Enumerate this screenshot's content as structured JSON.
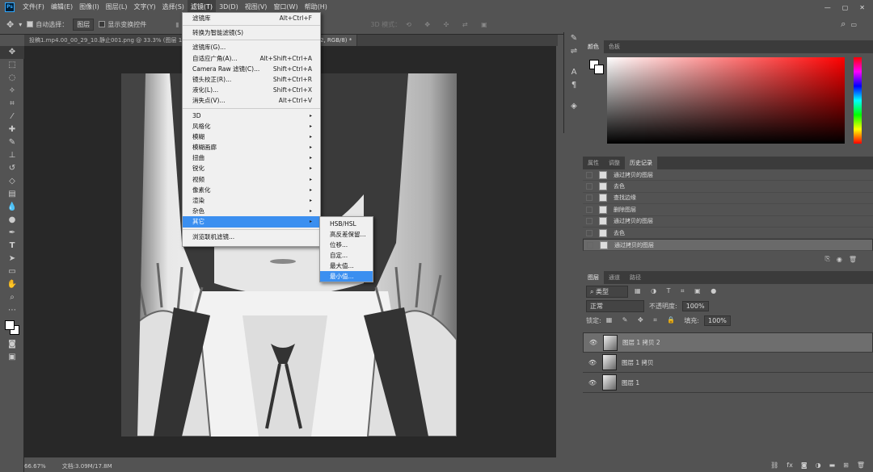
{
  "menubar": {
    "items": [
      "文件(F)",
      "编辑(E)",
      "图像(I)",
      "图层(L)",
      "文字(Y)",
      "选择(S)",
      "滤镜(T)",
      "3D(D)",
      "视图(V)",
      "窗口(W)",
      "帮助(H)"
    ],
    "active_index": 6
  },
  "options": {
    "auto_select_label": "自动选择：",
    "auto_select_value": "图层",
    "show_transform_label": "显示变换控件",
    "mode_3d_label": "3D 模式："
  },
  "tabs": [
    {
      "label": "投稿1.mp4.00_00_29_10.静止001.png @ 33.3% (图层 1 拷贝 2, RGB/8)",
      "active": false
    },
    {
      "label": "2, RGB/8) *",
      "active": true
    }
  ],
  "status": {
    "zoom": "66.67%",
    "doc": "文档:3.09M/17.8M"
  },
  "filter_menu": {
    "items": [
      {
        "label": "滤镜库",
        "shortcut": "Alt+Ctrl+F"
      },
      {
        "sep": true
      },
      {
        "label": "转换为智能滤镜(S)",
        "shortcut": ""
      },
      {
        "sep": true
      },
      {
        "label": "滤镜库(G)...",
        "shortcut": ""
      },
      {
        "label": "自适应广角(A)...",
        "shortcut": "Alt+Shift+Ctrl+A"
      },
      {
        "label": "Camera Raw 滤镜(C)...",
        "shortcut": "Shift+Ctrl+A"
      },
      {
        "label": "镜头校正(R)...",
        "shortcut": "Shift+Ctrl+R"
      },
      {
        "label": "液化(L)...",
        "shortcut": "Shift+Ctrl+X"
      },
      {
        "label": "消失点(V)...",
        "shortcut": "Alt+Ctrl+V"
      },
      {
        "sep": true
      },
      {
        "label": "3D",
        "arrow": true
      },
      {
        "label": "风格化",
        "arrow": true
      },
      {
        "label": "模糊",
        "arrow": true
      },
      {
        "label": "模糊画廊",
        "arrow": true
      },
      {
        "label": "扭曲",
        "arrow": true
      },
      {
        "label": "锐化",
        "arrow": true
      },
      {
        "label": "视频",
        "arrow": true
      },
      {
        "label": "像素化",
        "arrow": true
      },
      {
        "label": "渲染",
        "arrow": true
      },
      {
        "label": "杂色",
        "arrow": true
      },
      {
        "label": "其它",
        "arrow": true,
        "highlight": true
      },
      {
        "sep": true
      },
      {
        "label": "浏览联机滤镜...",
        "shortcut": ""
      }
    ]
  },
  "other_submenu": {
    "items": [
      "HSB/HSL",
      "高反差保留...",
      "位移...",
      "自定...",
      "最大值...",
      "最小值..."
    ],
    "highlight_index": 5
  },
  "color_panel": {
    "tabs": [
      "颜色",
      "色板"
    ]
  },
  "history_panel": {
    "tabs": [
      "属性",
      "调整",
      "历史记录"
    ],
    "items": [
      "通过拷贝的图层",
      "去色",
      "查找边缘",
      "删除图层",
      "通过拷贝的图层",
      "去色",
      "通过拷贝的图层"
    ],
    "selected_index": 6
  },
  "layers_panel": {
    "tabs": [
      "图层",
      "通道",
      "路径"
    ],
    "kind_label": "类型",
    "blend_mode": "正常",
    "opacity_label": "不透明度:",
    "opacity_value": "100%",
    "lock_label": "锁定:",
    "fill_label": "填充:",
    "fill_value": "100%",
    "layers": [
      {
        "name": "图层 1 拷贝 2",
        "selected": true
      },
      {
        "name": "图层 1 拷贝",
        "selected": false
      },
      {
        "name": "图层 1",
        "selected": false
      }
    ]
  },
  "colors": {
    "menu_highlight": "#3b8ff0",
    "panel_bg": "#535353",
    "canvas_bg": "#282828"
  }
}
